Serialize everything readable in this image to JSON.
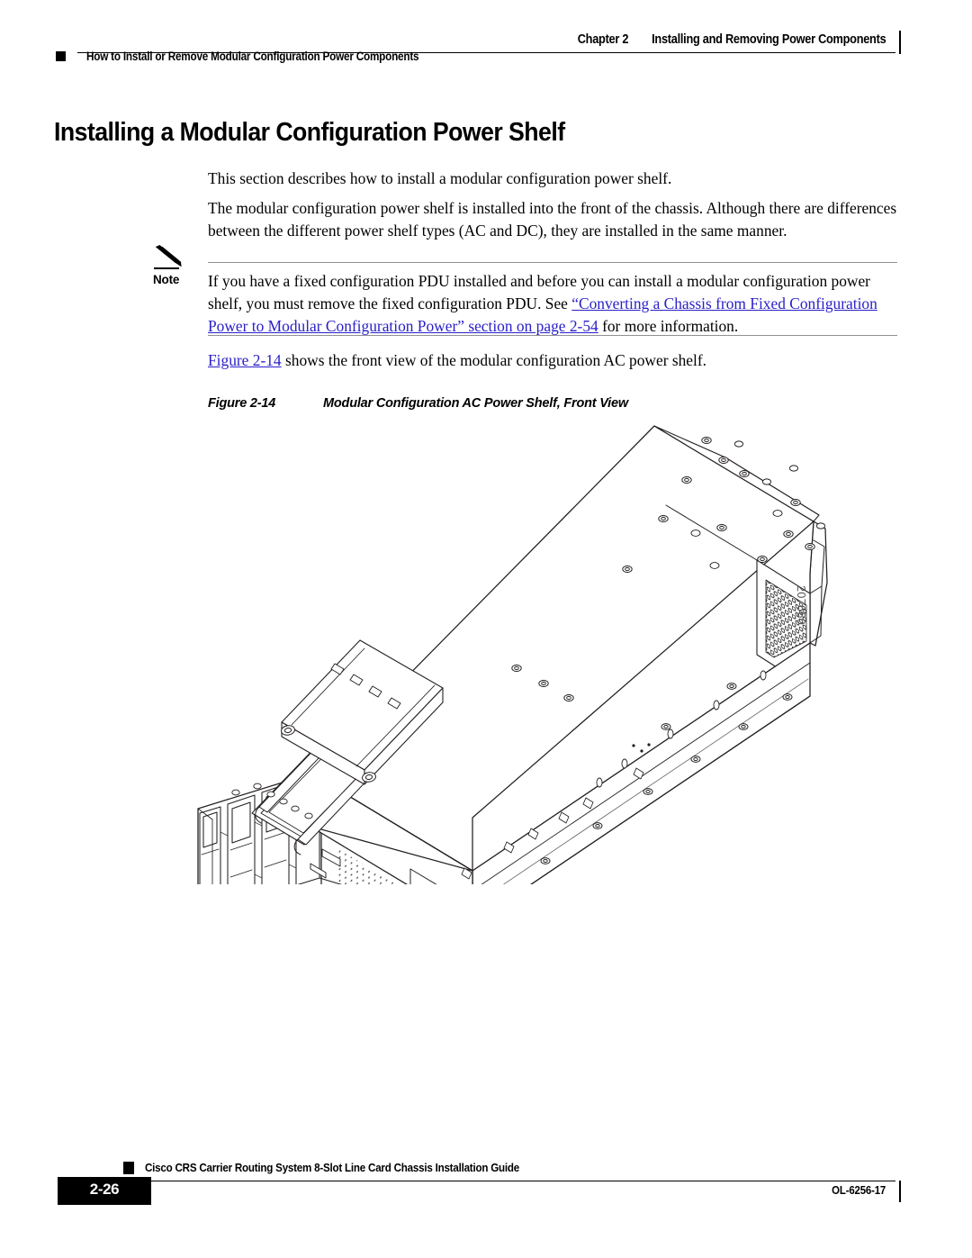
{
  "header": {
    "chapter_label": "Chapter 2",
    "chapter_title": "Installing and Removing Power Components",
    "section_title": "How to Install or Remove Modular Configuration Power Components"
  },
  "heading": "Installing a Modular Configuration Power Shelf",
  "paragraphs": {
    "intro": "This section describes how to install a modular configuration power shelf.",
    "detail": "The modular configuration power shelf is installed into the front of the chassis. Although there are differences between the different power shelf types (AC and DC), they are installed in the same manner."
  },
  "note": {
    "label": "Note",
    "text_before_link": "If you have a fixed configuration PDU installed and before you can install a modular configuration power shelf, you must remove the fixed configuration PDU. See ",
    "link_text": "“Converting a Chassis from Fixed Configuration Power to Modular Configuration Power” section on page 2-54",
    "text_after_link": " for more information."
  },
  "figure_reference": {
    "link_text": "Figure 2-14",
    "text_after_link": " shows the front view of the modular configuration AC power shelf."
  },
  "figure": {
    "caption_number": "Figure 2-14",
    "caption_title": "Modular Configuration AC Power Shelf, Front View",
    "artwork_id": "207660",
    "description": "Isometric line drawing of a modular configuration AC power shelf chassis, front three-quarter view, showing power module bays, perforated ventilation panels, a recessed carrying handle, captive fasteners, and a honeycomb mesh grille on the rear panel."
  },
  "footer": {
    "guide_title": "Cisco CRS Carrier Routing System 8-Slot Line Card Chassis Installation Guide",
    "page_number": "2-26",
    "doc_number": "OL-6256-17"
  },
  "colors": {
    "link": "#2a20c8",
    "text": "#000000",
    "rule": "#909090",
    "page_box": "#000000"
  }
}
